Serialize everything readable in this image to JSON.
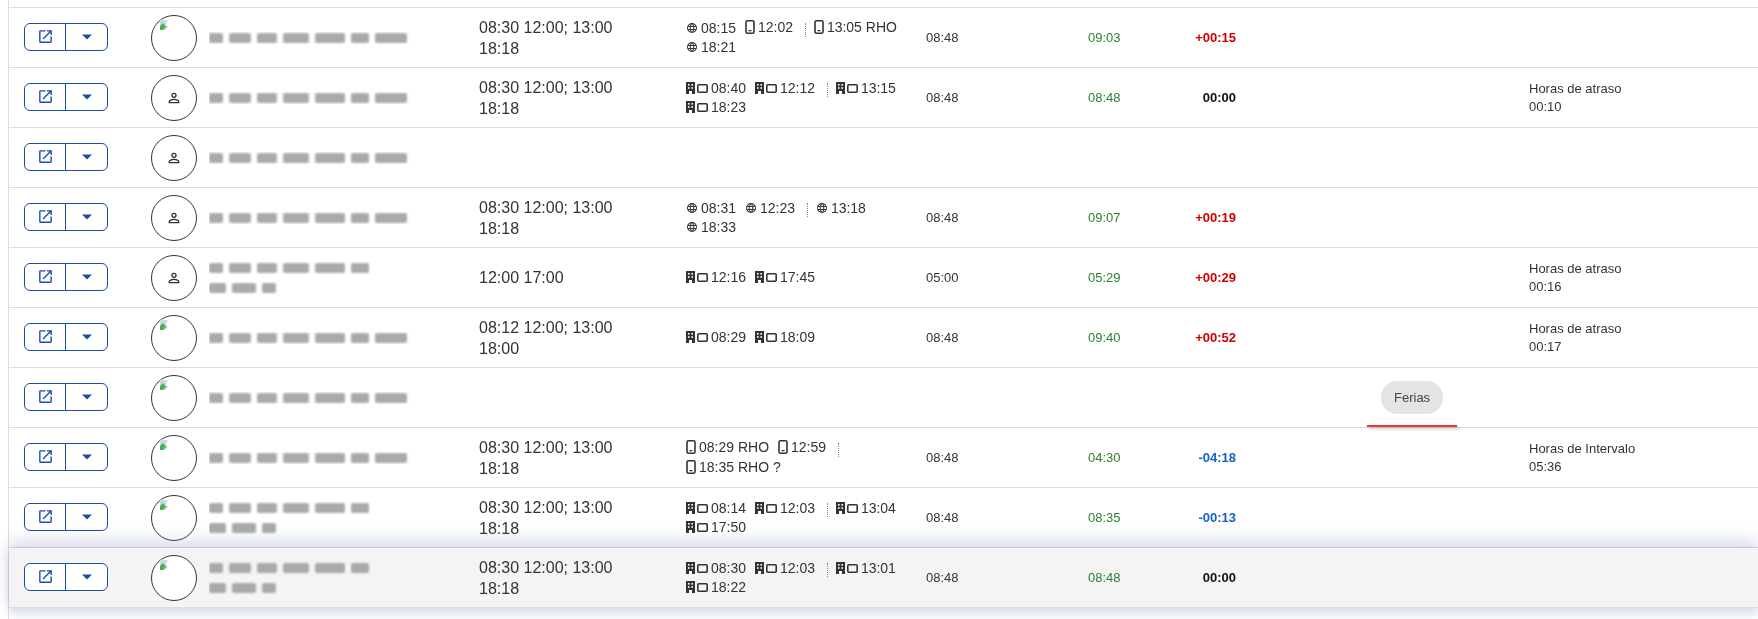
{
  "rows": [
    {
      "avatar": {
        "kind": "broken"
      },
      "name_wraps": false,
      "schedule": [
        "08:30 12:00; 13:00",
        "18:18"
      ],
      "punch_groups": [
        {
          "punches": [
            {
              "kind": "globe",
              "time": "08:15"
            },
            {
              "kind": "phone",
              "time": "12:02"
            }
          ]
        },
        {
          "punches": [
            {
              "kind": "phone",
              "time": "13:05 RHO"
            },
            {
              "kind": "globe",
              "time": "18:21"
            }
          ]
        }
      ],
      "expected": "08:48",
      "worked": "09:03",
      "balance": {
        "kind": "late",
        "text": "+00:15"
      },
      "highlighted": false
    },
    {
      "avatar": {
        "kind": "person"
      },
      "name_wraps": false,
      "schedule": [
        "08:30 12:00; 13:00",
        "18:18"
      ],
      "punch_groups": [
        {
          "punches": [
            {
              "kind": "terminal",
              "time": "08:40"
            },
            {
              "kind": "terminal",
              "time": "12:12"
            }
          ]
        },
        {
          "punches": [
            {
              "kind": "terminal",
              "time": "13:15"
            },
            {
              "kind": "terminal",
              "time": "18:23"
            }
          ]
        }
      ],
      "expected": "08:48",
      "worked": "08:48",
      "balance": {
        "kind": "zero",
        "text": "00:00"
      },
      "note": [
        "Horas de atraso",
        "00:10"
      ],
      "highlighted": false
    },
    {
      "avatar": {
        "kind": "person"
      },
      "name_wraps": false,
      "highlighted": false
    },
    {
      "avatar": {
        "kind": "person"
      },
      "name_wraps": false,
      "schedule": [
        "08:30 12:00; 13:00",
        "18:18"
      ],
      "punch_groups": [
        {
          "punches": [
            {
              "kind": "globe",
              "time": "08:31"
            },
            {
              "kind": "globe",
              "time": "12:23"
            }
          ]
        },
        {
          "punches": [
            {
              "kind": "globe",
              "time": "13:18"
            },
            {
              "kind": "globe",
              "time": "18:33"
            }
          ]
        }
      ],
      "expected": "08:48",
      "worked": "09:07",
      "balance": {
        "kind": "late",
        "text": "+00:19"
      },
      "highlighted": false
    },
    {
      "avatar": {
        "kind": "person"
      },
      "name_wraps": true,
      "schedule": [
        "12:00 17:00"
      ],
      "punch_groups": [
        {
          "punches": [
            {
              "kind": "terminal",
              "time": "12:16"
            },
            {
              "kind": "terminal",
              "time": "17:45"
            }
          ]
        }
      ],
      "expected": "05:00",
      "worked": "05:29",
      "balance": {
        "kind": "late",
        "text": "+00:29"
      },
      "note": [
        "Horas de atraso",
        "00:16"
      ],
      "highlighted": false
    },
    {
      "avatar": {
        "kind": "broken"
      },
      "name_wraps": false,
      "schedule": [
        "08:12 12:00; 13:00",
        "18:00"
      ],
      "punch_groups": [
        {
          "punches": [
            {
              "kind": "terminal",
              "time": "08:29"
            },
            {
              "kind": "terminal",
              "time": "18:09"
            }
          ]
        }
      ],
      "expected": "08:48",
      "worked": "09:40",
      "balance": {
        "kind": "late",
        "text": "+00:52"
      },
      "note": [
        "Horas de atraso",
        "00:17"
      ],
      "highlighted": false
    },
    {
      "avatar": {
        "kind": "broken"
      },
      "name_wraps": false,
      "absence": "Ferias",
      "highlighted": false
    },
    {
      "avatar": {
        "kind": "broken"
      },
      "name_wraps": false,
      "schedule": [
        "08:30 12:00; 13:00",
        "18:18"
      ],
      "punch_groups": [
        {
          "punches": [
            {
              "kind": "phone",
              "time": "08:29 RHO"
            },
            {
              "kind": "phone",
              "time": "12:59"
            }
          ]
        },
        {
          "punches": [
            {
              "kind": "phone",
              "time": "18:35 RHO ?"
            }
          ]
        }
      ],
      "expected": "08:48",
      "worked": "04:30",
      "balance": {
        "kind": "early",
        "text": "-04:18"
      },
      "note": [
        "Horas de Intervalo",
        "05:36"
      ],
      "highlighted": false
    },
    {
      "avatar": {
        "kind": "broken"
      },
      "name_wraps": true,
      "schedule": [
        "08:30 12:00; 13:00",
        "18:18"
      ],
      "punch_groups": [
        {
          "punches": [
            {
              "kind": "terminal",
              "time": "08:14"
            },
            {
              "kind": "terminal",
              "time": "12:03"
            }
          ]
        },
        {
          "punches": [
            {
              "kind": "terminal",
              "time": "13:04"
            },
            {
              "kind": "terminal",
              "time": "17:50"
            }
          ]
        }
      ],
      "expected": "08:48",
      "worked": "08:35",
      "balance": {
        "kind": "early",
        "text": "-00:13"
      },
      "highlighted": false
    },
    {
      "avatar": {
        "kind": "broken"
      },
      "name_wraps": true,
      "schedule": [
        "08:30 12:00; 13:00",
        "18:18"
      ],
      "punch_groups": [
        {
          "punches": [
            {
              "kind": "terminal",
              "time": "08:30"
            },
            {
              "kind": "terminal",
              "time": "12:03"
            }
          ]
        },
        {
          "punches": [
            {
              "kind": "terminal",
              "time": "13:01"
            },
            {
              "kind": "terminal",
              "time": "18:22"
            }
          ]
        }
      ],
      "expected": "08:48",
      "worked": "08:48",
      "balance": {
        "kind": "zero",
        "text": "00:00"
      },
      "highlighted": true
    }
  ]
}
